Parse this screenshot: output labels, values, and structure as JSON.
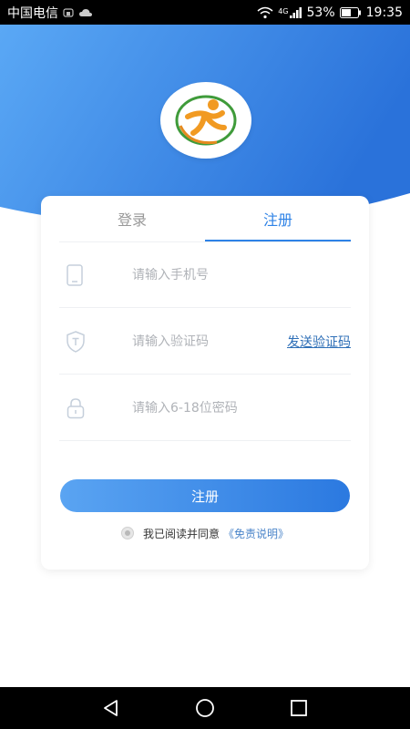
{
  "status_bar": {
    "carrier": "中国电信",
    "network": "4G",
    "battery": "53%",
    "time": "19:35"
  },
  "colors": {
    "primary": "#2e82e6",
    "header_light": "#5aa8f5",
    "header_dark": "#2a72da",
    "link": "#2e6fb7"
  },
  "logo": {
    "icon": "running-person-logo"
  },
  "tabs": [
    {
      "label": "登录",
      "active": false
    },
    {
      "label": "注册",
      "active": true
    }
  ],
  "form": {
    "phone": {
      "placeholder": "请输入手机号",
      "value": "",
      "icon": "phone-icon"
    },
    "code": {
      "placeholder": "请输入验证码",
      "value": "",
      "icon": "shield-icon",
      "send_label": "发送验证码"
    },
    "password": {
      "placeholder": "请输入6-18位密码",
      "value": "",
      "icon": "lock-icon"
    },
    "submit_label": "注册"
  },
  "agreement": {
    "text": "我已阅读并同意",
    "link": "《免责说明》"
  },
  "nav": {
    "back": "back-icon",
    "home": "home-icon",
    "recents": "recents-icon"
  }
}
